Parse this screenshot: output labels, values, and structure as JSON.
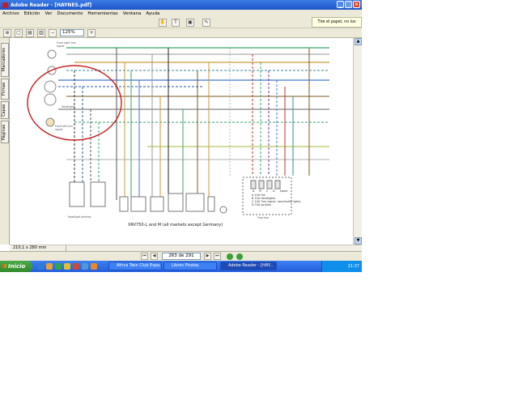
{
  "window": {
    "title": "Adobe Reader - [HAYNES.pdf]"
  },
  "menu": [
    "Archivo",
    "Edición",
    "Ver",
    "Documento",
    "Herramientas",
    "Ventana",
    "Ayuda"
  ],
  "toolbar": {
    "zoom_value": "125%"
  },
  "notice": "Tire el papel, no los datos",
  "side_tabs": [
    "Marcadores",
    "Firmas",
    "Capas",
    "Páginas"
  ],
  "document": {
    "caption": "XRV750-L and M (all markets except Germany)",
    "labels": {
      "front_right_turn": "Front right turn signal",
      "headlights": "Headlights",
      "front_left_turn": "Front left turn signal",
      "headlight_dimmer": "Headlight dimmer",
      "fuse_box": "Fuse box",
      "fuse_a": "A",
      "fuse_b": "B",
      "fuse_c": "C",
      "fuse_d": "D",
      "spare": "Spare",
      "fuse_rows": [
        "A 10A Fan",
        "B 15A Headlights",
        "C 10A Turn signal, horn/brake lights",
        "D 10A Ignition"
      ]
    }
  },
  "status": {
    "size": "210,1 x 280 mm",
    "page": "263 de 291"
  },
  "taskbar": {
    "start": "Inicio",
    "tasks": [
      "Africa Twin Club Espa...",
      "Libros Piratas",
      "Adobe Reader - [HAY..."
    ],
    "lang": "ES",
    "clock": "21:37"
  }
}
